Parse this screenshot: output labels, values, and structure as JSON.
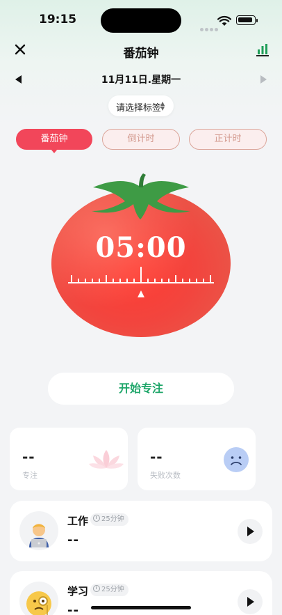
{
  "status_bar": {
    "time": "19:15"
  },
  "nav": {
    "title": "番茄钟",
    "close_icon": "close-icon",
    "stats_icon": "bar-chart-icon"
  },
  "date": {
    "text": "11月11日.星期一"
  },
  "tag_selector": {
    "label": "请选择标签"
  },
  "modes": [
    {
      "label": "番茄钟",
      "active": true
    },
    {
      "label": "倒计时",
      "active": false
    },
    {
      "label": "正计时",
      "active": false
    }
  ],
  "timer": {
    "display": "05:00"
  },
  "start_button": {
    "label": "开始专注"
  },
  "stats": {
    "focus": {
      "value": "--",
      "label": "专注"
    },
    "fail": {
      "value": "--",
      "label": "失败次数"
    }
  },
  "tasks": [
    {
      "name": "工作",
      "duration": "25分钟",
      "value": "--"
    },
    {
      "name": "学习",
      "duration": "25分钟",
      "value": "--"
    }
  ],
  "colors": {
    "accent_red": "#f2465a",
    "accent_green": "#1fa66a",
    "tomato": "#f0443c",
    "leaf": "#3e9b45"
  }
}
